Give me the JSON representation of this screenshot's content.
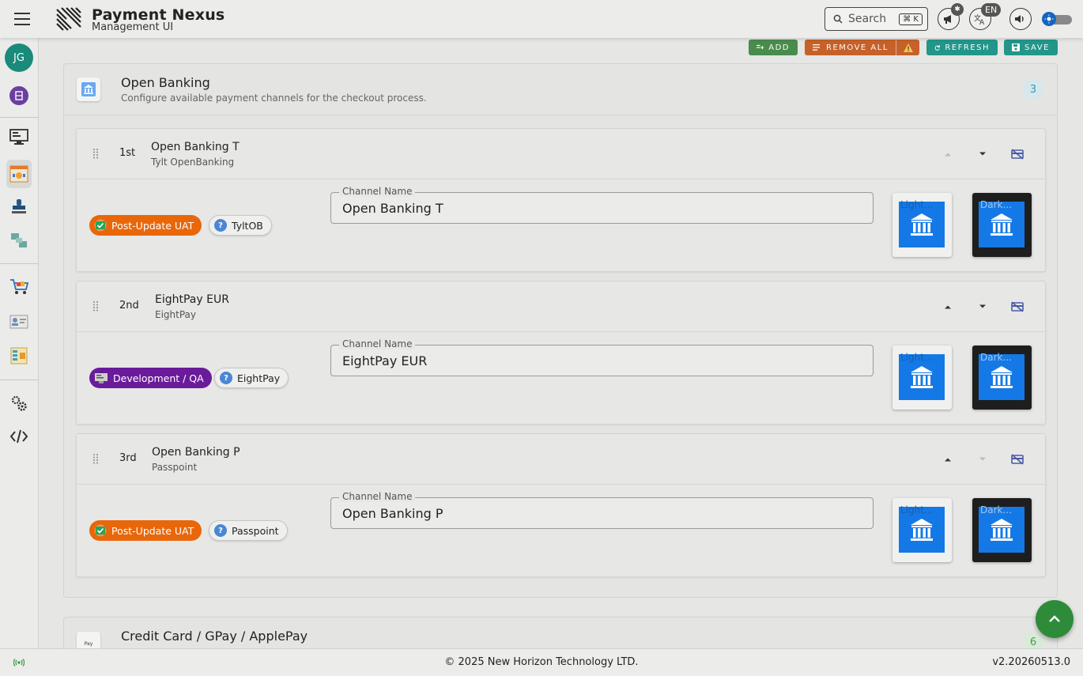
{
  "header": {
    "brand_title": "Payment Nexus",
    "brand_subtitle": "Management UI",
    "search_placeholder": "Search",
    "search_shortcut": "⌘ K",
    "language": "EN"
  },
  "sidebar": {
    "avatar_initials": "JG",
    "items": [
      {
        "icon": "app-badge-icon"
      },
      {
        "icon": "monitor-icon"
      },
      {
        "icon": "payment-window-icon",
        "active": true
      },
      {
        "icon": "stamp-icon"
      },
      {
        "icon": "transfer-icon"
      },
      {
        "icon": "cart-icon"
      },
      {
        "icon": "id-card-icon"
      },
      {
        "icon": "dashboard-icon"
      },
      {
        "icon": "settings-icon"
      },
      {
        "icon": "code-icon"
      }
    ]
  },
  "toolbar": {
    "add_label": "ADD",
    "remove_all_label": "REMOVE ALL",
    "refresh_label": "REFRESH",
    "save_label": "SAVE"
  },
  "section": {
    "title": "Open Banking",
    "description": "Configure available payment channels for the checkout process.",
    "count": "3"
  },
  "channels": [
    {
      "rank": "1st",
      "title": "Open Banking T",
      "subtitle": "Tylt OpenBanking",
      "environment": "Post-Update UAT",
      "env_color": "#e8670a",
      "provider": "TyltOB",
      "field_label": "Channel Name",
      "channel_name": "Open Banking T",
      "light_label": "Light...",
      "dark_label": "Dark..."
    },
    {
      "rank": "2nd",
      "title": "EightPay EUR",
      "subtitle": "EightPay",
      "environment": "Development / QA",
      "env_color": "#6a1b9a",
      "provider": "EightPay",
      "field_label": "Channel Name",
      "channel_name": "EightPay EUR",
      "light_label": "Light...",
      "dark_label": "Dark..."
    },
    {
      "rank": "3rd",
      "title": "Open Banking P",
      "subtitle": "Passpoint",
      "environment": "Post-Update UAT",
      "env_color": "#e8670a",
      "provider": "Passpoint",
      "field_label": "Channel Name",
      "channel_name": "Open Banking P",
      "light_label": "Light...",
      "dark_label": "Dark..."
    }
  ],
  "section2": {
    "title": "Credit Card / GPay / ApplePay",
    "count": "6",
    "icon_text": "Pay"
  },
  "footer": {
    "copyright": "© 2025 New Horizon Technology LTD.",
    "version": "v2.20260513.0"
  }
}
